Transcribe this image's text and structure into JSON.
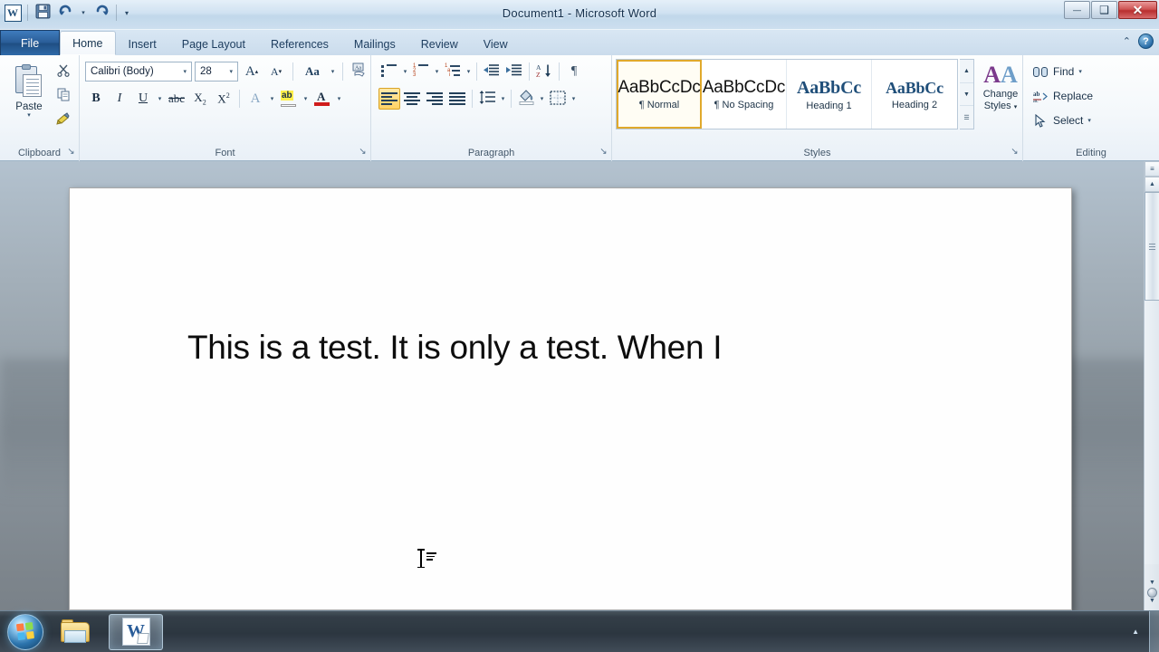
{
  "window": {
    "title": "Document1  -  Microsoft Word",
    "minimize_label": "—",
    "restore_label": "❑",
    "close_label": "✕"
  },
  "quick_access": {
    "app_logo": "W",
    "items": [
      {
        "name": "save",
        "label": "Save",
        "icon": "floppy-disk-icon"
      },
      {
        "name": "undo",
        "label": "Undo",
        "icon": "undo-arrow-icon"
      },
      {
        "name": "redo",
        "label": "Redo",
        "icon": "redo-arrow-icon"
      }
    ],
    "customize_label": "▾"
  },
  "ribbon": {
    "tabs": [
      {
        "label": "File",
        "active": false,
        "file": true
      },
      {
        "label": "Home",
        "active": true,
        "file": false
      },
      {
        "label": "Insert",
        "active": false,
        "file": false
      },
      {
        "label": "Page Layout",
        "active": false,
        "file": false
      },
      {
        "label": "References",
        "active": false,
        "file": false
      },
      {
        "label": "Mailings",
        "active": false,
        "file": false
      },
      {
        "label": "Review",
        "active": false,
        "file": false
      },
      {
        "label": "View",
        "active": false,
        "file": false
      }
    ],
    "minimize_ribbon_label": "⌃",
    "help_label": "?",
    "groups": {
      "clipboard": {
        "label": "Clipboard",
        "paste_label": "Paste",
        "paste_caret": "▾",
        "cut_label": "Cut",
        "copy_label": "Copy",
        "format_painter_label": "Format Painter",
        "launcher": "↘"
      },
      "font": {
        "label": "Font",
        "font_name": "Calibri (Body)",
        "font_size": "28",
        "grow_font_label": "A",
        "shrink_font_label": "A",
        "change_case_label": "Aa",
        "clear_formatting_label": "Clear Formatting",
        "bold_label": "B",
        "italic_label": "I",
        "underline_label": "U",
        "strikethrough_label": "abc",
        "subscript_label": "X",
        "superscript_label": "X",
        "text_effects_label": "A",
        "highlight_label": "ab",
        "font_color_label": "A",
        "caret": "▾",
        "launcher": "↘"
      },
      "paragraph": {
        "label": "Paragraph",
        "bullets_label": "Bullets",
        "numbering_label": "Numbering",
        "multilevel_label": "Multilevel List",
        "decrease_indent_label": "Decrease Indent",
        "increase_indent_label": "Increase Indent",
        "sort_label": "Sort",
        "show_marks_label": "¶",
        "align_left_label": "Align Text Left",
        "align_center_label": "Center",
        "align_right_label": "Align Text Right",
        "justify_label": "Justify",
        "line_spacing_label": "Line and Paragraph Spacing",
        "shading_label": "Shading",
        "borders_label": "Borders",
        "active_alignment": "align-left",
        "caret": "▾",
        "launcher": "↘"
      },
      "styles": {
        "label": "Styles",
        "items": [
          {
            "preview": "AaBbCcDc",
            "name": "¶ Normal",
            "selected": true,
            "kind": "body"
          },
          {
            "preview": "AaBbCcDc",
            "name": "¶ No Spacing",
            "selected": false,
            "kind": "body"
          },
          {
            "preview": "AaBbCc",
            "name": "Heading 1",
            "selected": false,
            "kind": "h1"
          },
          {
            "preview": "AaBbCc",
            "name": "Heading 2",
            "selected": false,
            "kind": "h2"
          }
        ],
        "nav_up": "▲",
        "nav_down": "▼",
        "nav_more": "☰",
        "change_styles_line1": "Change",
        "change_styles_line2": "Styles",
        "change_styles_caret": "▾",
        "change_styles_icon_a1": "A",
        "change_styles_icon_a2": "A",
        "launcher": "↘"
      },
      "editing": {
        "label": "Editing",
        "items": [
          {
            "label": "Find",
            "icon": "binoculars-icon",
            "caret": "▾"
          },
          {
            "label": "Replace",
            "icon": "replace-icon",
            "caret": ""
          },
          {
            "label": "Select",
            "icon": "cursor-arrow-icon",
            "caret": "▾"
          }
        ]
      }
    }
  },
  "document": {
    "body_text": "This is a test. It is only a test. When I",
    "cursor_icon": "text-ibeam-cursor"
  },
  "scrollbar": {
    "up_arrow": "▲",
    "down_arrow": "▼",
    "split_label": "≡",
    "browse_up": "▲",
    "browse_down": "▼",
    "select_browse_object": "Select Browse Object"
  },
  "taskbar": {
    "start_label": "Start",
    "items": [
      {
        "name": "windows-explorer",
        "label": "Windows Explorer",
        "active": false
      },
      {
        "name": "microsoft-word",
        "label": "Document1 - Microsoft Word",
        "active": true
      }
    ],
    "tray_arrow": "▲",
    "show_desktop_label": "Show desktop"
  },
  "colors": {
    "accent": "#1f4e79",
    "tab_file": "#2a5d98",
    "selection_gold": "#e0a92c",
    "close_red": "#b82f2f",
    "highlight_yellow": "#ffef4a",
    "font_color_red": "#d01c1c"
  }
}
